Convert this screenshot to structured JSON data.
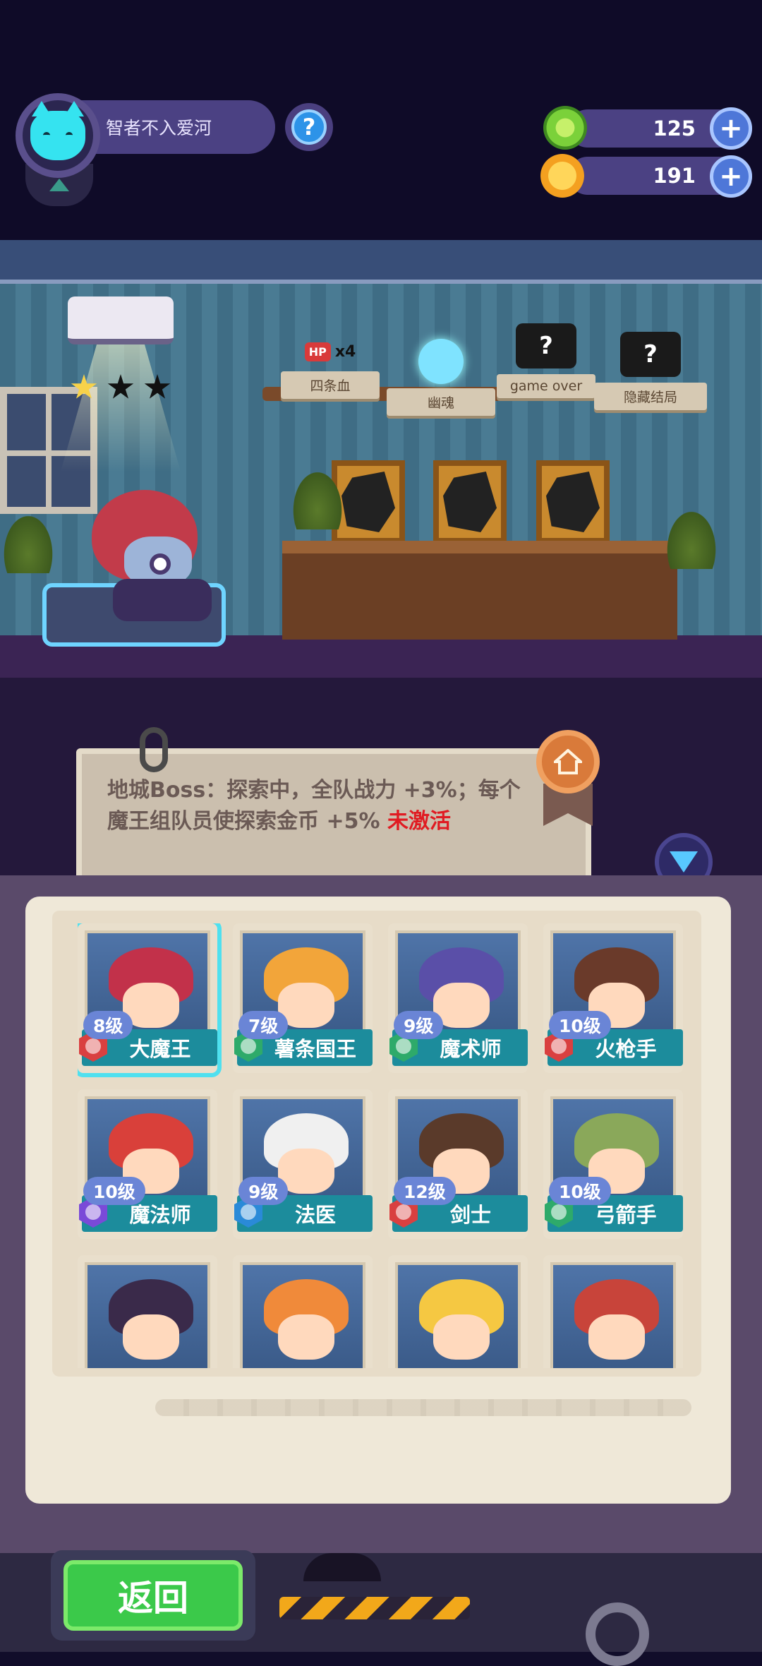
{
  "profile": {
    "player_name": "智者不入爱河",
    "help_label": "?"
  },
  "currencies": [
    {
      "name": "gem",
      "amount": "125",
      "color": "#7bd13a"
    },
    {
      "name": "coin",
      "amount": "191",
      "color": "#f4a020"
    }
  ],
  "plus_label": "+",
  "room": {
    "star_rating": 1,
    "star_max": 3,
    "achievements": [
      {
        "label": "四条血",
        "badge": "HP",
        "count": "x4"
      },
      {
        "label": "幽魂"
      },
      {
        "label": "game over",
        "badge": "?"
      },
      {
        "label": "隐藏结局",
        "badge": "?"
      }
    ]
  },
  "bonus": {
    "text": "地城Boss：探索中，全队战力 +3%；每个魔王组队员使探索金币 +5%",
    "status": "未激活"
  },
  "heroes": [
    {
      "level": "8级",
      "name": "大魔王",
      "color": "#c2314a",
      "emblem": "#d94040",
      "selected": true
    },
    {
      "level": "7级",
      "name": "薯条国王",
      "color": "#f2a53a",
      "emblem": "#2eaa6a"
    },
    {
      "level": "9级",
      "name": "魔术师",
      "color": "#5a4fa8",
      "emblem": "#2eaa6a"
    },
    {
      "level": "10级",
      "name": "火枪手",
      "color": "#6a3a2a",
      "emblem": "#d94040"
    },
    {
      "level": "10级",
      "name": "魔法师",
      "color": "#d9403a",
      "emblem": "#7a4ad8"
    },
    {
      "level": "9级",
      "name": "法医",
      "color": "#f0f0f0",
      "emblem": "#2a8ad8"
    },
    {
      "level": "12级",
      "name": "剑士",
      "color": "#5a3a2a",
      "emblem": "#d94040"
    },
    {
      "level": "10级",
      "name": "弓箭手",
      "color": "#8aa85a",
      "emblem": "#2eaa6a"
    },
    {
      "color": "#3a2a4a"
    },
    {
      "color": "#f08a3a"
    },
    {
      "color": "#f5c842"
    },
    {
      "color": "#c8443a"
    }
  ],
  "back_label": "返回"
}
